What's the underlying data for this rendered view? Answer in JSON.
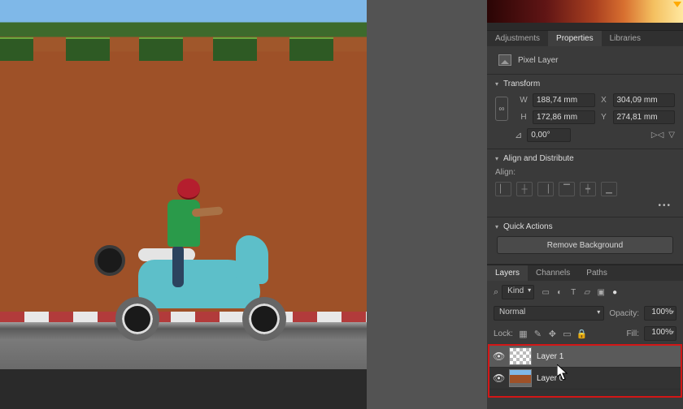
{
  "tabs_main": {
    "adjustments": "Adjustments",
    "properties": "Properties",
    "libraries": "Libraries"
  },
  "pixel_layer_label": "Pixel Layer",
  "transform": {
    "title": "Transform",
    "w_label": "W",
    "w": "188,74 mm",
    "x_label": "X",
    "x": "304,09 mm",
    "h_label": "H",
    "h": "172,86 mm",
    "y_label": "Y",
    "y": "274,81 mm",
    "angle": "0,00°"
  },
  "align": {
    "title": "Align and Distribute",
    "sub": "Align:"
  },
  "quick_actions": {
    "title": "Quick Actions",
    "remove_bg": "Remove Background"
  },
  "layers_tabs": {
    "layers": "Layers",
    "channels": "Channels",
    "paths": "Paths"
  },
  "layers": {
    "kind": "Kind",
    "blend": "Normal",
    "opacity_label": "Opacity:",
    "opacity": "100%",
    "lock_label": "Lock:",
    "fill_label": "Fill:",
    "fill": "100%",
    "items": [
      {
        "name": "Layer 1",
        "selected": true,
        "thumb": "checker"
      },
      {
        "name": "Layer 0",
        "selected": false,
        "thumb": "img"
      }
    ]
  }
}
